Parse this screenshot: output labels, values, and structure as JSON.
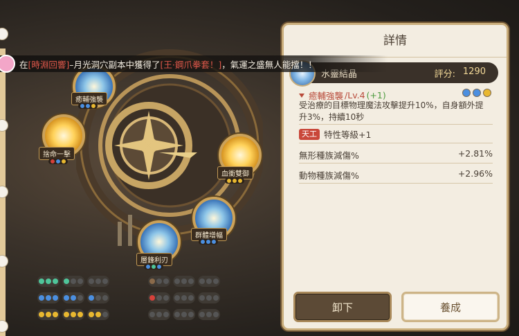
{
  "announcement": {
    "prefix": "在",
    "location": "[時淵回響]",
    "middle": "–月光洞穴副本中獲得了",
    "item": "[王·鋼爪拳套！]",
    "suffix": "，氣運之盛無人能擋！！"
  },
  "machine": {
    "nodes": [
      {
        "label": "癒輔強襲"
      },
      {
        "label": "捨命一擊"
      },
      {
        "label": "血衝雙御"
      },
      {
        "label": "群體增幅"
      },
      {
        "label": "層鋒利刃"
      }
    ]
  },
  "panel": {
    "title": "詳情",
    "crystal_name": "水靈結晶",
    "score_label": "評分:",
    "score_value": "1290",
    "skill_name": "癒輔強襲",
    "skill_level": "/Lv.4",
    "skill_bonus": "(+1)",
    "skill_desc": "受治療的目標物理魔法攻擊提升10%，自身額外提升3%，持續10秒",
    "trait_tag": "天工",
    "trait_text": "特性等級+1",
    "stats": [
      {
        "name": "無形種族減傷%",
        "value": "+2.81%"
      },
      {
        "name": "動物種族減傷%",
        "value": "+2.96%"
      }
    ],
    "btn_unequip": "卸下",
    "btn_nurture": "養成"
  },
  "colors": {
    "panel_bg": "#f3ede1",
    "accent_red": "#c9473a",
    "gold": "#cba25a",
    "socket_green": "#4fc59a",
    "socket_blue": "#4b8fe0",
    "socket_yellow": "#e9b830",
    "socket_red": "#d6413a"
  },
  "icons": {
    "announce": "avatar-pink-icon",
    "crystal": "water-crystal-icon",
    "expand": "triangle-down-icon"
  }
}
